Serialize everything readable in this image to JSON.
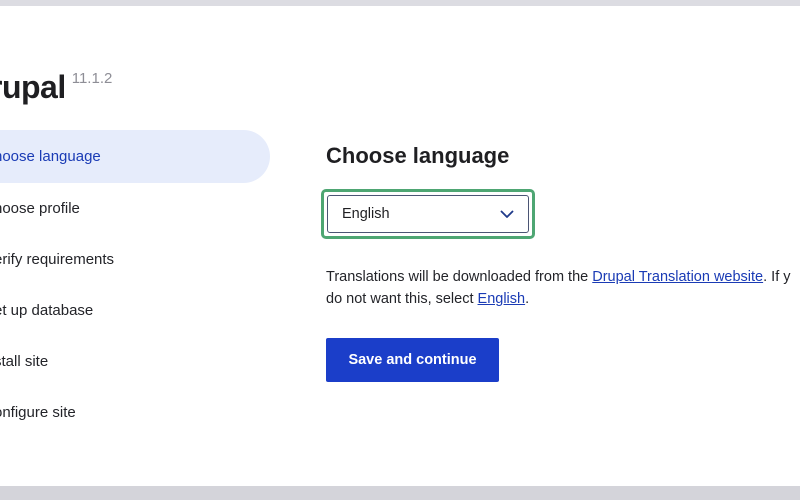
{
  "brand": {
    "name": "rupal",
    "version": "11.1.2"
  },
  "steps": [
    {
      "label": "hoose language",
      "active": true
    },
    {
      "label": "hoose profile",
      "active": false
    },
    {
      "label": "erify requirements",
      "active": false
    },
    {
      "label": "et up database",
      "active": false
    },
    {
      "label": "stall site",
      "active": false
    },
    {
      "label": "onfigure site",
      "active": false
    }
  ],
  "main": {
    "heading": "Choose language",
    "language_select": {
      "selected": "English",
      "icon": "chevron-down-icon"
    },
    "description": {
      "part1": "Translations will be downloaded from the ",
      "link1": "Drupal Translation website",
      "part2": ". If y",
      "part3": "do not want this, select ",
      "link2": "English",
      "part4": "."
    },
    "save_button": "Save and continue"
  },
  "colors": {
    "accent": "#1b3ec9",
    "active_step_bg": "#e6ecfb",
    "focus_ring": "#4ea673"
  }
}
